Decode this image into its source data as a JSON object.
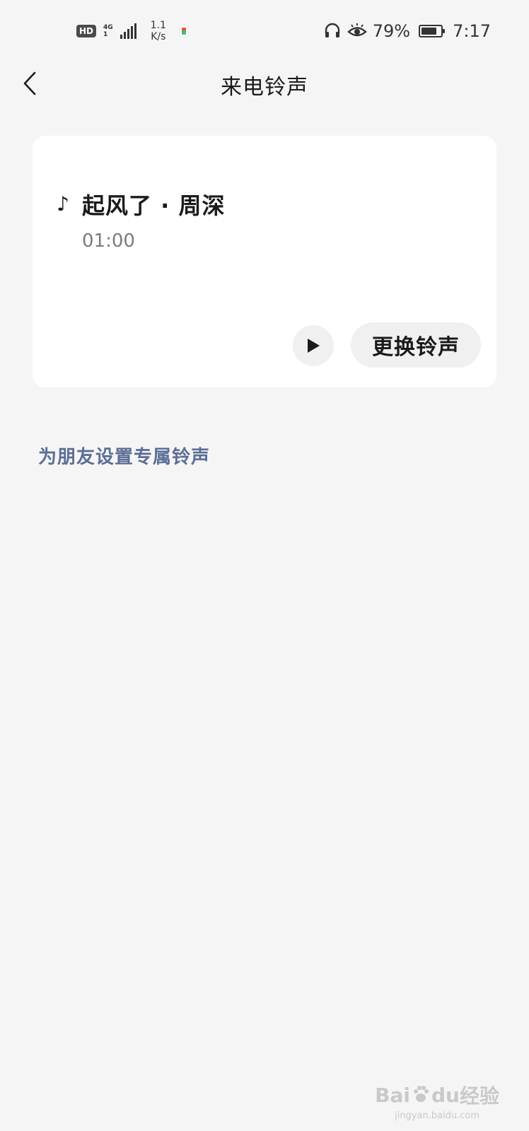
{
  "status_bar": {
    "hd_label": "HD",
    "network_type": "4G",
    "network_sub": "1",
    "speed_value": "1.1",
    "speed_unit": "K/s",
    "battery_percent": "79%",
    "battery_level": 0.79,
    "time": "7:17"
  },
  "header": {
    "title": "来电铃声"
  },
  "ringtone_card": {
    "song_title": "起风了 · 周深",
    "duration": "01:00",
    "change_button_label": "更换铃声"
  },
  "links": {
    "friend_ringtone_label": "为朋友设置专属铃声"
  },
  "watermark": {
    "brand_left": "Bai",
    "brand_mid": "du",
    "brand_right": "经验",
    "url": "jingyan.baidu.com"
  },
  "colors": {
    "background": "#f5f5f5",
    "card": "#ffffff",
    "link": "#5c6e96",
    "button_bg": "#f0f0f0"
  }
}
